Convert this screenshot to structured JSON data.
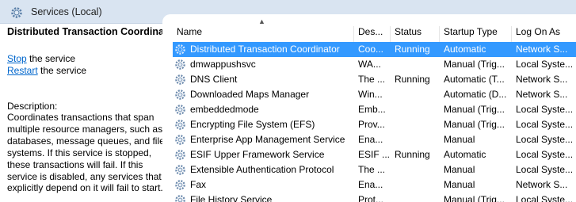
{
  "window": {
    "title": "Services (Local)",
    "icon": "services-gear-icon"
  },
  "detail": {
    "service_name": "Distributed Transaction Coordinator",
    "actions": [
      {
        "link": "Stop",
        "rest": " the service"
      },
      {
        "link": "Restart",
        "rest": " the service"
      }
    ],
    "description_label": "Description:",
    "description": "Coordinates transactions that span multiple resource managers, such as databases, message queues, and file systems. If this service is stopped, these transactions will fail. If this service is disabled, any services that explicitly depend on it will fail to start."
  },
  "columns": [
    "Name",
    "Des...",
    "Status",
    "Startup Type",
    "Log On As"
  ],
  "services": [
    {
      "name": "Distributed Transaction Coordinator",
      "desc": "Coo...",
      "status": "Running",
      "startup": "Automatic",
      "logon": "Network S...",
      "selected": true
    },
    {
      "name": "dmwappushsvc",
      "desc": "WA...",
      "status": "",
      "startup": "Manual (Trig...",
      "logon": "Local Syste..."
    },
    {
      "name": "DNS Client",
      "desc": "The ...",
      "status": "Running",
      "startup": "Automatic (T...",
      "logon": "Network S..."
    },
    {
      "name": "Downloaded Maps Manager",
      "desc": "Win...",
      "status": "",
      "startup": "Automatic (D...",
      "logon": "Network S..."
    },
    {
      "name": "embeddedmode",
      "desc": "Emb...",
      "status": "",
      "startup": "Manual (Trig...",
      "logon": "Local Syste..."
    },
    {
      "name": "Encrypting File System (EFS)",
      "desc": "Prov...",
      "status": "",
      "startup": "Manual (Trig...",
      "logon": "Local Syste..."
    },
    {
      "name": "Enterprise App Management Service",
      "desc": "Ena...",
      "status": "",
      "startup": "Manual",
      "logon": "Local Syste..."
    },
    {
      "name": "ESIF Upper Framework Service",
      "desc": "ESIF ...",
      "status": "Running",
      "startup": "Automatic",
      "logon": "Local Syste..."
    },
    {
      "name": "Extensible Authentication Protocol",
      "desc": "The ...",
      "status": "",
      "startup": "Manual",
      "logon": "Local Syste..."
    },
    {
      "name": "Fax",
      "desc": "Ena...",
      "status": "",
      "startup": "Manual",
      "logon": "Network S..."
    },
    {
      "name": "File History Service",
      "desc": "Prot...",
      "status": "",
      "startup": "Manual (Trig...",
      "logon": "Local Syste..."
    }
  ]
}
